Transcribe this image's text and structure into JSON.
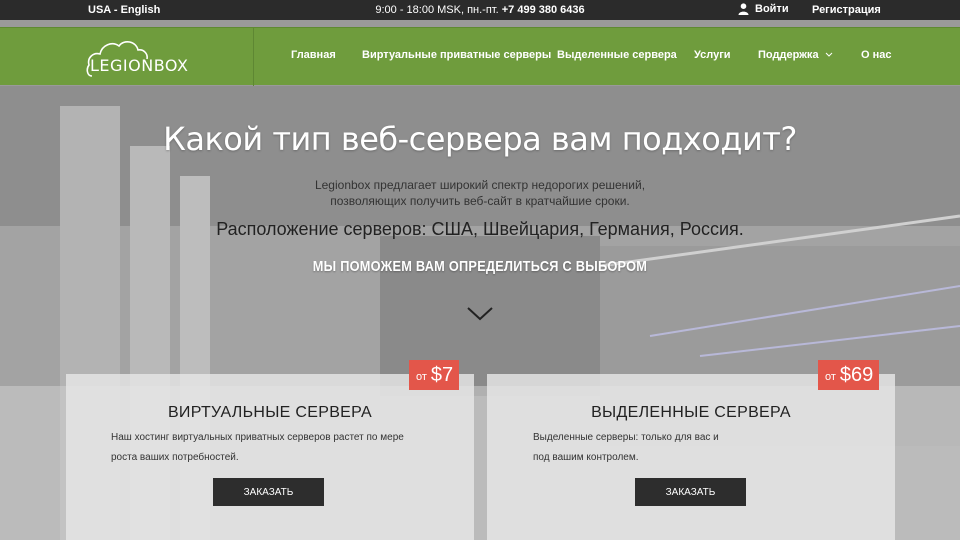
{
  "topbar": {
    "language": "USA - English",
    "hours": "9:00 - 18:00 MSK, пн.-пт.",
    "phone": "+7 499 380 6436",
    "login": "Войти",
    "register": "Регистрация"
  },
  "nav": {
    "logo": "LEGIONBOX",
    "items": [
      {
        "label": "Главная"
      },
      {
        "label": "Виртуальные приватные серверы"
      },
      {
        "label": "Выделенные сервера"
      },
      {
        "label": "Услуги"
      },
      {
        "label": "Поддержка"
      },
      {
        "label": "О нас"
      }
    ]
  },
  "hero": {
    "title": "Какой тип веб-сервера вам подходит?",
    "subtitle_line1": "Legionbox предлагает широкий спектр недорогих решений,",
    "subtitle_line2": "позволяющих получить веб-сайт в кратчайшие сроки.",
    "locations": "Расположение серверов: США, Швейцария, Германия, Россия.",
    "help": "МЫ ПОМОЖЕМ ВАМ ОПРЕДЕЛИТЬСЯ С ВЫБОРОМ"
  },
  "cards": [
    {
      "price_from": "от",
      "price": "$7",
      "title": "ВИРТУАЛЬНЫЕ СЕРВЕРА",
      "desc_line1": "Наш хостинг виртуальных приватных серверов растет по мере",
      "desc_line2": "роста ваших потребностей.",
      "button": "ЗАКАЗАТЬ"
    },
    {
      "price_from": "от",
      "price": "$69",
      "title": "ВЫДЕЛЕННЫЕ СЕРВЕРА",
      "desc_line1": "Выделенные серверы: только для вас и",
      "desc_line2": "под вашим контролем.",
      "button": "ЗАКАЗАТЬ"
    }
  ],
  "icons": {
    "user": "user-icon",
    "dropdown": "chevron-down-icon",
    "scroll": "chevron-down-icon",
    "logo": "cloud-icon"
  },
  "colors": {
    "topbar": "#2b2b2b",
    "nav": "#6f9c3d",
    "price_badge": "#e3564a",
    "button": "#2d2d2d"
  }
}
